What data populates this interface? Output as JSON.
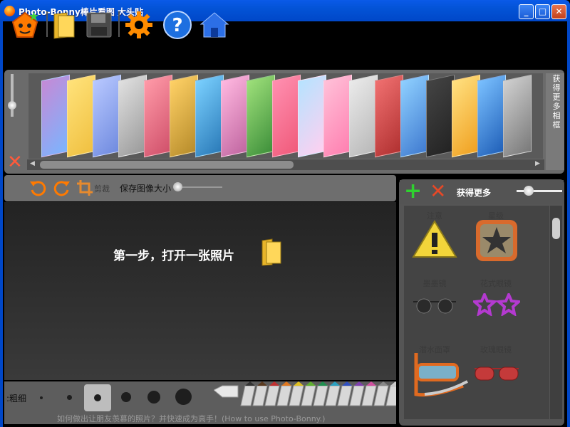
{
  "window": {
    "title": "Photo-Bonny棒片看图 大头贴",
    "minimize": "_",
    "maximize": "□",
    "close": "✕"
  },
  "toolbar": {
    "items": [
      "app-logo-icon",
      "open-folder-icon",
      "save-disk-icon",
      "settings-gear-icon",
      "help-question-icon",
      "home-icon"
    ]
  },
  "frames_strip": {
    "side_label": "获得更多相框",
    "left_arrow": "◀",
    "right_arrow": "▶",
    "slider_level": 0.65,
    "scroll_position": 0.05
  },
  "edit_bar": {
    "crop_label": "剪裁",
    "save_size_label": "保存图像大小",
    "save_size_level": 0.0
  },
  "canvas": {
    "instruction": "第一步，打开一张照片"
  },
  "brush_bar": {
    "thickness_label": ":粗细",
    "selected_size_index": 2,
    "hint": "如何做出让朋友羡慕的照片？并快速成为高手！(How to use Photo-Bonny.)"
  },
  "sticker_panel": {
    "more_label": "获得更多",
    "zoom_level": 0.3,
    "items": [
      {
        "label": "注意",
        "icon": "warning-triangle-icon"
      },
      {
        "label": "星级",
        "icon": "star-badge-icon"
      },
      {
        "label": "墨墨镜",
        "icon": "sunglasses-icon"
      },
      {
        "label": "花式眼镜",
        "icon": "flower-glasses-icon"
      },
      {
        "label": "潜水面罩",
        "icon": "diving-mask-icon"
      },
      {
        "label": "玫瑰眼镜",
        "icon": "rose-glasses-icon"
      }
    ]
  },
  "colors": {
    "accent_blue": "#0353d6",
    "panel_gray": "#6b6b6b",
    "canvas_dark": "#2b2b2b",
    "red_x": "#e64827",
    "green_plus": "#2fd12f"
  }
}
